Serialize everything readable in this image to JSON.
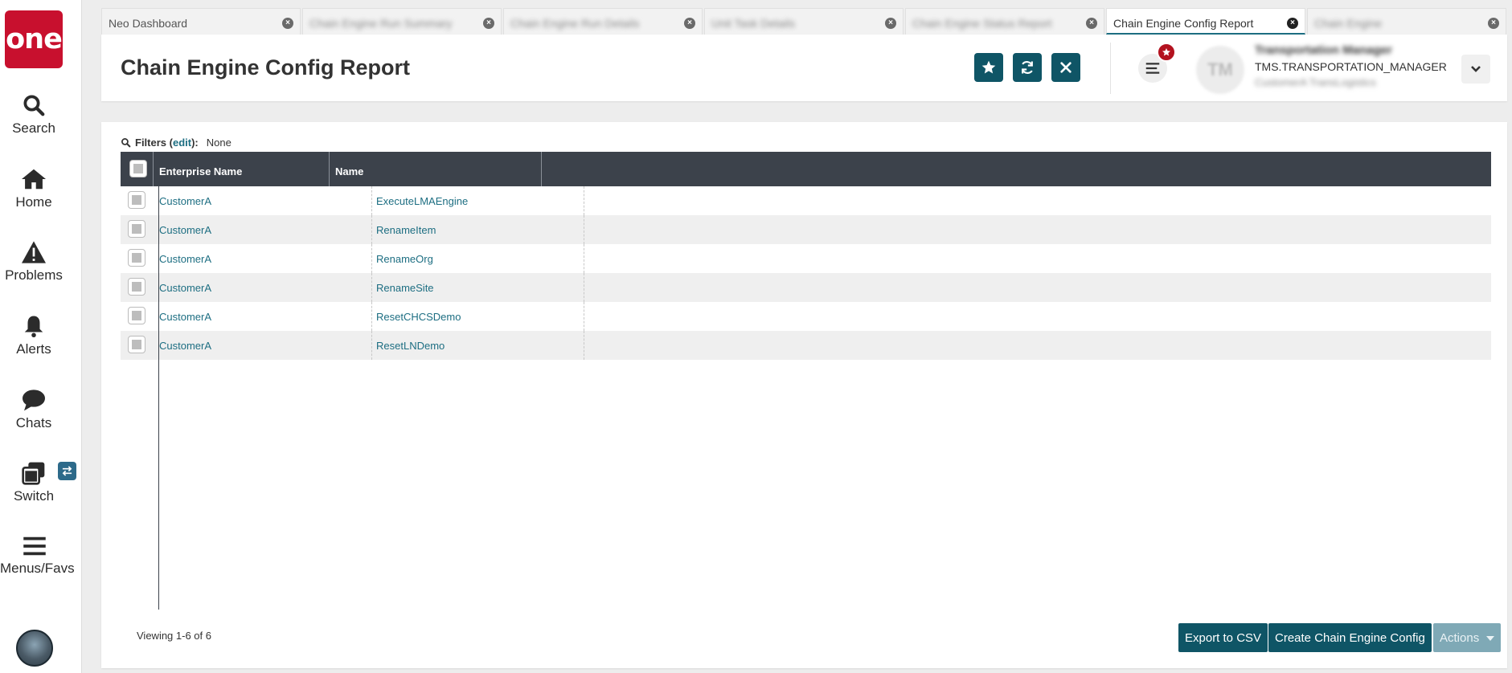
{
  "app": {
    "logo_text": "one",
    "brand_color": "#c8102e",
    "accent_color": "#0f5566"
  },
  "nav": {
    "items": [
      {
        "label": "Search",
        "icon": "search-icon"
      },
      {
        "label": "Home",
        "icon": "home-icon"
      },
      {
        "label": "Problems",
        "icon": "warning-icon"
      },
      {
        "label": "Alerts",
        "icon": "bell-icon"
      },
      {
        "label": "Chats",
        "icon": "chat-icon"
      },
      {
        "label": "Switch",
        "icon": "switch-icon"
      },
      {
        "label": "Menus/Favs",
        "icon": "hamburger-icon"
      }
    ]
  },
  "tabs": [
    {
      "label": "Neo Dashboard",
      "blurred": false
    },
    {
      "label": "Chain Engine Run Summary",
      "blurred": true
    },
    {
      "label": "Chain Engine Run Details",
      "blurred": true
    },
    {
      "label": "Unit Task Details",
      "blurred": true
    },
    {
      "label": "Chain Engine Status Report",
      "blurred": true
    },
    {
      "label": "Chain Engine Config Report",
      "blurred": false,
      "active": true
    },
    {
      "label": "Chain Engine",
      "blurred": true
    }
  ],
  "header": {
    "title": "Chain Engine Config Report"
  },
  "user": {
    "initials": "TM",
    "name": "Transportation Manager",
    "role": "TMS.TRANSPORTATION_MANAGER",
    "company": "CustomerA TransLogistics",
    "avatar_text": "TM"
  },
  "filters": {
    "label": "Filters",
    "edit_label": "edit",
    "value": "None"
  },
  "table": {
    "columns": [
      "Enterprise Name",
      "Name"
    ],
    "rows": [
      [
        "CustomerA",
        "ExecuteLMAEngine"
      ],
      [
        "CustomerA",
        "RenameItem"
      ],
      [
        "CustomerA",
        "RenameOrg"
      ],
      [
        "CustomerA",
        "RenameSite"
      ],
      [
        "CustomerA",
        "ResetCHCSDemo"
      ],
      [
        "CustomerA",
        "ResetLNDemo"
      ]
    ]
  },
  "footer": {
    "viewing": "Viewing 1-6 of 6",
    "export_label": "Export to CSV",
    "create_label": "Create Chain Engine Config",
    "actions_label": "Actions"
  }
}
